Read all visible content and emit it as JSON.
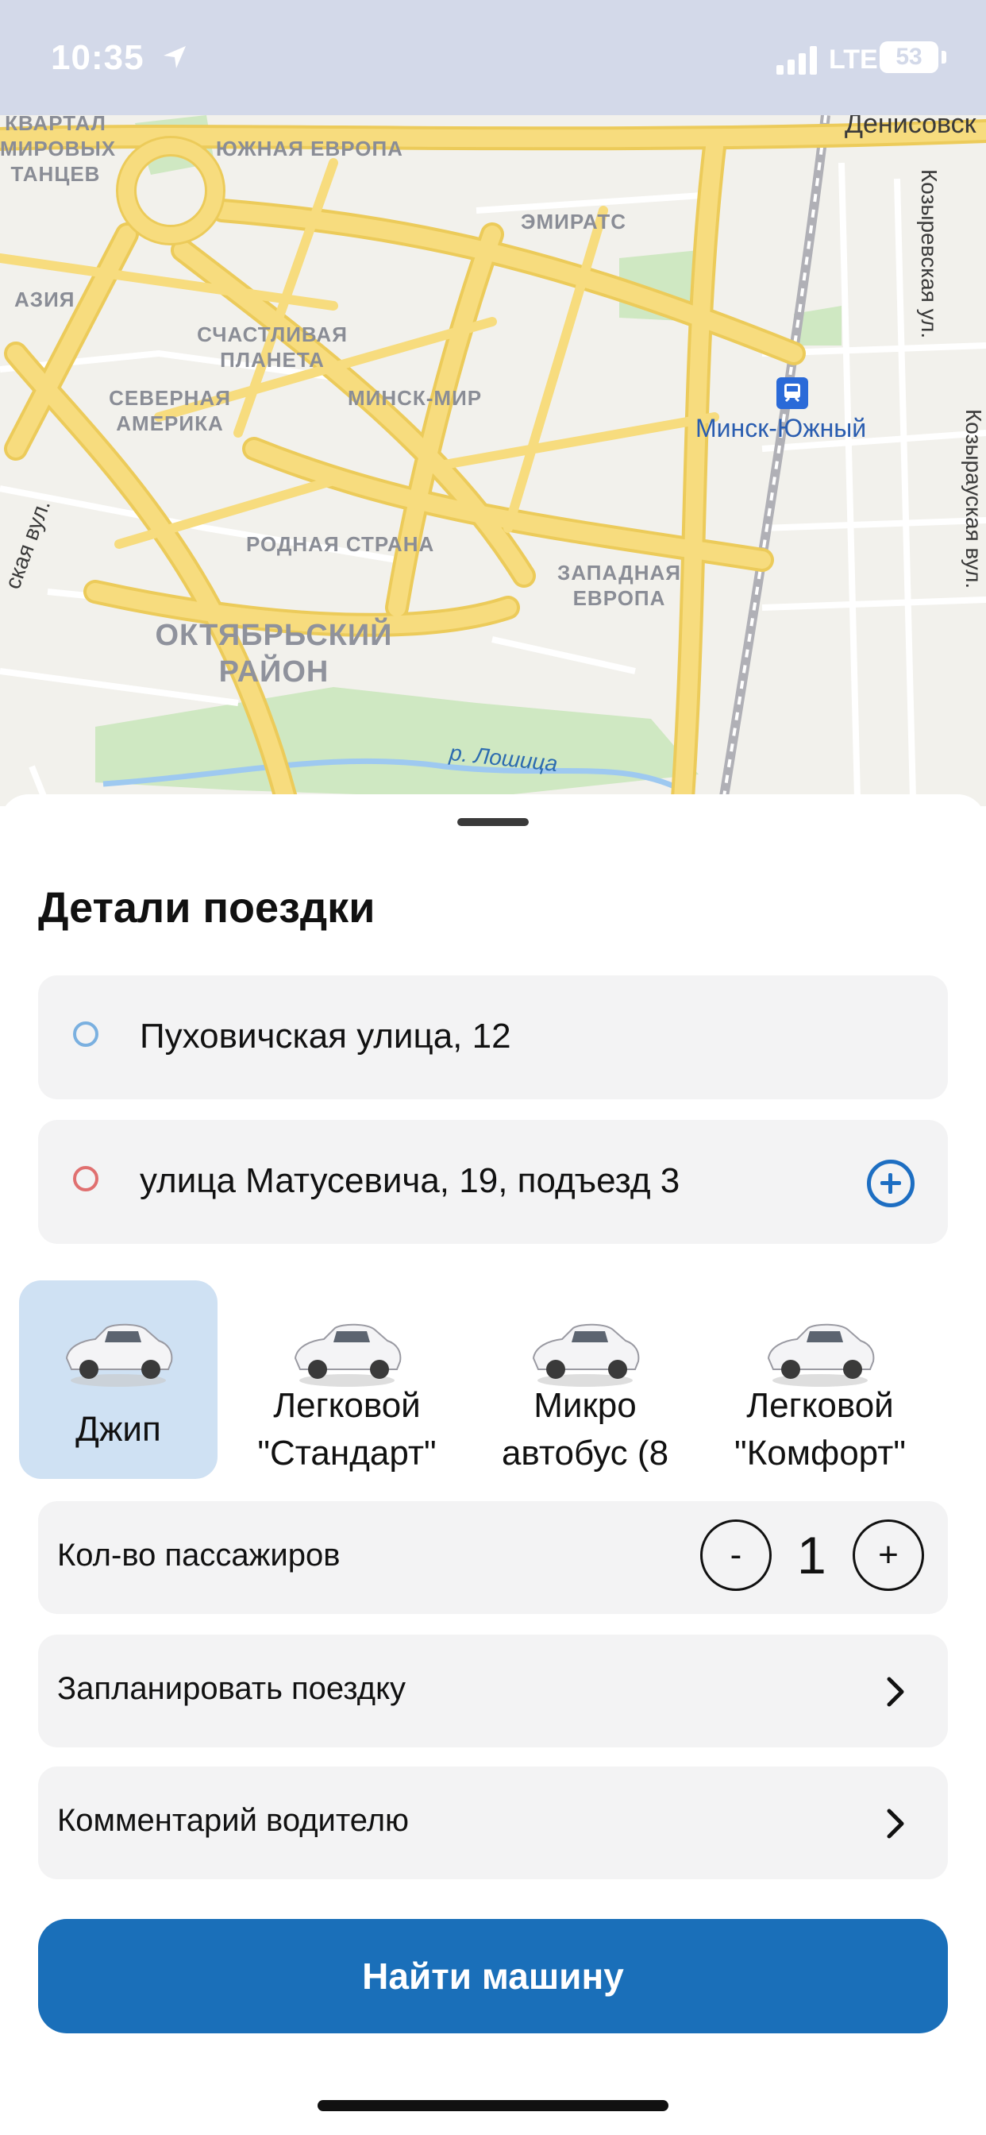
{
  "status_bar": {
    "time": "10:35",
    "network": "LTE",
    "battery": "53"
  },
  "map": {
    "labels": {
      "kvartal": "КВАРТАЛ\nМИРОВЫХ\nТАНЦЕВ",
      "yuzhnaya_evropa": "ЮЖНАЯ ЕВРОПА",
      "emirats": "ЭМИРАТС",
      "aziya": "АЗИЯ",
      "schastlivaya": "СЧАСТЛИВАЯ\nПЛАНЕТА",
      "severnaya": "СЕВЕРНАЯ\nАМЕРИКА",
      "minsk_mir": "МИНСК-МИР",
      "rodnaya": "РОДНАЯ СТРАНА",
      "zapadnaya": "ЗАПАДНАЯ\nЕВРОПА",
      "district": "ОКТЯБРЬСКИЙ\nРАЙОН"
    },
    "streets": {
      "denisovsk": "Денисовск",
      "kozyrevskaya_1": "Козыревская ул.",
      "kozyrevskaya_2": "Козырауская вул.",
      "left_vul": "ская вул.",
      "river": "р. Лошица"
    },
    "metro": "Минск-Южный",
    "colors": {
      "road": "#f7dc7e",
      "road_edge": "#eccb5a",
      "park": "#cfe8c2",
      "water": "#9ec9f0",
      "background": "#f2f1ec"
    }
  },
  "sheet": {
    "title": "Детали поездки",
    "from": "Пуховичская улица, 12",
    "to": "улица Матусевича, 19, подъезд 3",
    "from_color": "#7ab0e0",
    "to_color": "#e07070"
  },
  "vehicles": [
    {
      "label": "Джип",
      "selected": true
    },
    {
      "label": "Легковой\n\"Стандарт\"",
      "selected": false
    },
    {
      "label": "Микро\nавтобус (8",
      "selected": false
    },
    {
      "label": "Легковой\n\"Комфорт\"",
      "selected": false
    }
  ],
  "passengers": {
    "label": "Кол-во пассажиров",
    "minus": "-",
    "value": "1",
    "plus": "+"
  },
  "schedule": {
    "label": "Запланировать поездку"
  },
  "comment": {
    "label": "Комментарий водителю"
  },
  "cta": {
    "label": "Найти машину",
    "color": "#1a6fb9"
  }
}
